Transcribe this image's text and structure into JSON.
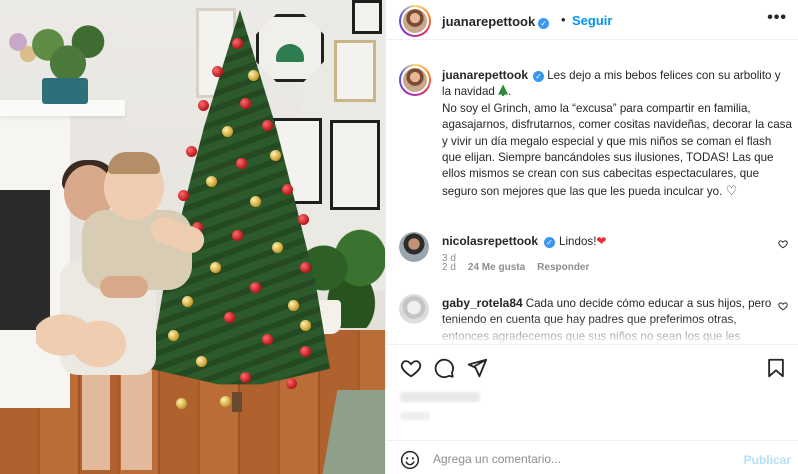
{
  "post": {
    "image_alt": "Dos niños junto a un árbol de navidad",
    "author": {
      "username": "juanarepettook",
      "verified": true
    },
    "header": {
      "follow_label": "Seguir",
      "dot": "•",
      "more_icon": "more-horizontal-icon"
    },
    "caption": {
      "text_part1": " Les dejo a mis bebos felices con su arbolito y la navidad ",
      "text_part2": ".",
      "text_body": "No soy el Grinch, amo la “excusa” para compartir en familia, agasajarnos, disfrutarnos, comer cositas navideñas, decorar la casa y vivir un día megalo especial y que mis niños se coman el flash que elijan. Siempre bancándoles sus ilusiones, TODAS! Las que ellos mismos se crean con sus cabecitas espectaculares, que seguro son mejores que las que les pueda inculcar yo. ",
      "heart": "♡",
      "time": "3 d"
    },
    "comments": [
      {
        "username": "nicolasrepettook",
        "verified": true,
        "text": "Lindos!",
        "emoji": "❤",
        "time": "2 d",
        "likes": "24 Me gusta",
        "reply": "Responder"
      },
      {
        "username": "gaby_rotela84",
        "verified": false,
        "text": "Cada uno decide cómo educar a sus hijos, pero teniendo en cuenta que hay padres que preferimos otras, entonces agradecemos que sus niños no sean los que les"
      }
    ],
    "actions": {
      "like_icon": "heart-icon",
      "comment_icon": "comment-icon",
      "share_icon": "share-icon",
      "save_icon": "bookmark-icon"
    },
    "add_comment": {
      "placeholder": "Agrega un comentario...",
      "publish_label": "Publicar",
      "emoji_icon": "smiley-icon"
    },
    "colors": {
      "link_blue": "#0095f6",
      "verified_blue": "#3897f0",
      "publish_disabled": "#b2dffc",
      "heart_red": "#ed2b3a",
      "meta_gray": "#8e8e8e"
    }
  }
}
